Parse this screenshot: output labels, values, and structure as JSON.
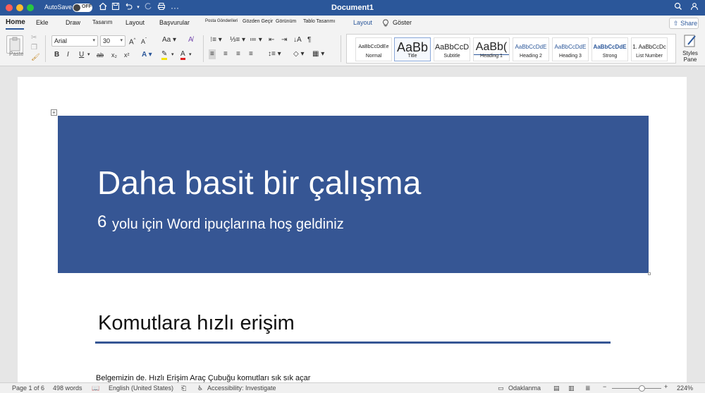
{
  "window": {
    "title": "Document1",
    "autosave_label": "AutoSave",
    "autosave_state": "OFF",
    "accent_color": "#2b579a"
  },
  "ribbon_tabs": {
    "home": "Home",
    "insert": "Ekle",
    "draw": "Draw",
    "design": "Tasarım",
    "layout": "Layout",
    "references": "Başvurular",
    "mailings": "Posta Gönderileri",
    "review": "Gözden Geçir",
    "view": "Görünüm",
    "table_design": "Tablo Tasarımı",
    "table_layout": "Layout",
    "tell_me": "Göster",
    "share": "Share"
  },
  "ribbon": {
    "paste_label": "Paste",
    "font_name": "Arial",
    "font_size": "30",
    "styles_pane_label": "Styles Pane",
    "styles": [
      {
        "sample": "AaBbCcDdEe",
        "name": "Normal"
      },
      {
        "sample": "AaBb",
        "name": "Title"
      },
      {
        "sample": "AaBbCcD",
        "name": "Subtitle"
      },
      {
        "sample": "AaBb(",
        "name": "Heading 1"
      },
      {
        "sample": "AaBbCcDdE",
        "name": "Heading 2"
      },
      {
        "sample": "AaBbCcDdE",
        "name": "Heading 3"
      },
      {
        "sample": "AaBbCcDdE",
        "name": "Strong"
      },
      {
        "sample": "1. AaBbCcDc",
        "name": "List Number"
      }
    ]
  },
  "document": {
    "banner_title": "Daha basit bir çalışma",
    "banner_number": "6",
    "banner_subtitle": "yolu için Word ipuçlarına hoş geldiniz",
    "banner_color": "#365694",
    "heading": "Komutlara hızlı erişim",
    "body_text": "Belgemizin de. Hızlı Erişim Araç Çubuğu komutları sık sık açar"
  },
  "status": {
    "page": "Page 1 of 6",
    "words": "498 words",
    "language": "English (United States)",
    "accessibility": "Accessibility: Investigate",
    "focus": "Odaklanma",
    "zoom": "224%"
  }
}
